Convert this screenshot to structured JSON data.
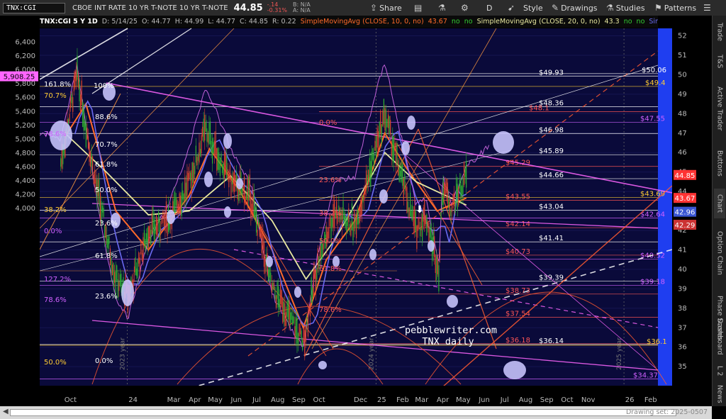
{
  "toolbar": {
    "symbol": "TNX:CGI",
    "description": "CBOE INT RATE 10 YR T-NOTE   10 YR T-NOTE",
    "last": "44.85",
    "change": "-.14",
    "change_pct": "-0.31%",
    "bid": "B: N/A",
    "ask": "A: N/A",
    "share": "Share",
    "aggregation": "D",
    "style": "Style",
    "drawings": "Drawings",
    "studies": "Studies",
    "patterns": "Patterns"
  },
  "study_bar": {
    "header": "TNX:CGI 5 Y 1D",
    "date": "D: 5/14/25",
    "open": "O: 44.77",
    "high": "H: 44.99",
    "low": "L: 44.77",
    "close": "C: 44.85",
    "range": "R: 0.22",
    "sma10": "SimpleMovingAvg (CLOSE, 10, 0, no)",
    "sma10_val": "43.67",
    "sma20": "SimpleMovingAvg (CLOSE, 20, 0, no)",
    "sma20_val": "43.3",
    "sma_other": "SimpleMoving...",
    "no": "no"
  },
  "right_tabs": [
    "Trade",
    "T&S",
    "Active Trader",
    "Buttons",
    "Chart",
    "Option Chain",
    "Phase Scores",
    "Dashboard",
    "L 2",
    "News"
  ],
  "drawing_set": "Drawing set: 2025-0507",
  "watermark": {
    "line1": "pebblewriter.com",
    "line2": "TNX daily"
  },
  "colors": {
    "bg": "#0a0a3a",
    "candle_up": "#2fb32f",
    "candle_down": "#e0452b",
    "sma10": "#ff6a2a",
    "sma20": "#e8e8a0",
    "sma50": "#6a6af0",
    "mauve": "#c060d8",
    "pink": "#ff66ff",
    "fib_orange": "#ff9a40",
    "white": "#ffffff"
  },
  "chart_data": {
    "type": "line",
    "title": "TNX:CGI 5 Y 1D",
    "right_axis": {
      "min": 34,
      "max": 52.5,
      "ticks": [
        35,
        36,
        37,
        38,
        39,
        40,
        41,
        42,
        43,
        44,
        45,
        46,
        47,
        48,
        49,
        50,
        51,
        52
      ]
    },
    "left_axis": {
      "ticks": [
        "4,000",
        "4,200",
        "4,400",
        "4,600",
        "4,800",
        "5,000",
        "5,200",
        "5,400",
        "5,600",
        "5,800",
        "6,000",
        "6,200",
        "6,400"
      ]
    },
    "x_ticks": [
      "Oct",
      "24",
      "Mar",
      "Apr",
      "May",
      "Jun",
      "Jul",
      "Aug",
      "Sep",
      "Oct",
      "Dec",
      "25",
      "Feb",
      "Mar",
      "Apr",
      "May",
      "Jun",
      "Jul",
      "Aug",
      "Sep",
      "Oct",
      "Nov",
      "26",
      "Feb"
    ],
    "year_labels": [
      "2023 year",
      "2024 year",
      "2025 year"
    ],
    "series": [
      {
        "name": "TNX close (approx.)",
        "x": [
          "2023-09-25",
          "2023-10-19",
          "2023-11-15",
          "2023-12-15",
          "2024-01-02",
          "2024-02-01",
          "2024-03-01",
          "2024-04-01",
          "2024-04-25",
          "2024-06-01",
          "2024-07-01",
          "2024-08-01",
          "2024-08-20",
          "2024-09-16",
          "2024-10-07",
          "2024-11-01",
          "2024-12-01",
          "2025-01-14",
          "2025-02-01",
          "2025-03-01",
          "2025-03-15",
          "2025-04-04",
          "2025-04-09",
          "2025-04-22",
          "2025-05-14"
        ],
        "values": [
          45.5,
          50.0,
          44.5,
          39.5,
          38.6,
          42.0,
          42.5,
          44.4,
          47.2,
          44.5,
          43.7,
          39.0,
          38.0,
          36.2,
          40.3,
          43.0,
          42.2,
          48.0,
          45.5,
          42.0,
          42.8,
          39.9,
          44.5,
          43.2,
          44.85
        ]
      },
      {
        "name": "SimpleMovingAvg (CLOSE, 10, 0, no)",
        "x": [
          "2023-10-01",
          "2023-11-01",
          "2023-12-15",
          "2024-02-01",
          "2024-04-01",
          "2024-05-01",
          "2024-06-15",
          "2024-08-01",
          "2024-09-16",
          "2024-10-20",
          "2024-12-01",
          "2025-01-14",
          "2025-02-15",
          "2025-04-01",
          "2025-05-14"
        ],
        "values": [
          46.8,
          48.5,
          43.0,
          41.0,
          43.8,
          46.2,
          44.0,
          41.0,
          37.0,
          40.5,
          42.5,
          47.0,
          45.2,
          43.0,
          43.67
        ]
      },
      {
        "name": "SimpleMovingAvg (CLOSE, 20, 0, no)",
        "x": [
          "2023-10-01",
          "2023-12-01",
          "2024-02-01",
          "2024-04-01",
          "2024-06-01",
          "2024-08-01",
          "2024-09-20",
          "2024-11-01",
          "2025-01-14",
          "2025-03-01",
          "2025-05-14"
        ],
        "values": [
          47.0,
          45.0,
          42.8,
          43.0,
          44.8,
          42.5,
          39.5,
          41.5,
          46.0,
          44.5,
          43.3
        ]
      }
    ],
    "price_levels": [
      {
        "label": "$50.06",
        "value": 50.06
      },
      {
        "label": "$49.93",
        "value": 49.93
      },
      {
        "label": "$49.4",
        "value": 49.4
      },
      {
        "label": "$48.36",
        "value": 48.36
      },
      {
        "label": "$48.1",
        "value": 48.1
      },
      {
        "label": "$47.55",
        "value": 47.55
      },
      {
        "label": "$46.98",
        "value": 46.98
      },
      {
        "label": "$45.89",
        "value": 45.89
      },
      {
        "label": "$45.29",
        "value": 45.29
      },
      {
        "label": "$44.66",
        "value": 44.66
      },
      {
        "label": "$43.69",
        "value": 43.69
      },
      {
        "label": "$43.55",
        "value": 43.55
      },
      {
        "label": "$43.04",
        "value": 43.04
      },
      {
        "label": "$42.64",
        "value": 42.64
      },
      {
        "label": "$42.14",
        "value": 42.14
      },
      {
        "label": "$41.41",
        "value": 41.41
      },
      {
        "label": "$40.73",
        "value": 40.73
      },
      {
        "label": "$40.52",
        "value": 40.52
      },
      {
        "label": "$39.39",
        "value": 39.39
      },
      {
        "label": "$39.18",
        "value": 39.18
      },
      {
        "label": "$38.73",
        "value": 38.73
      },
      {
        "label": "$37.54",
        "value": 37.54
      },
      {
        "label": "$36.18",
        "value": 36.18
      },
      {
        "label": "$36.14",
        "value": 36.14
      },
      {
        "label": "$36.1",
        "value": 36.1
      },
      {
        "label": "$34.37",
        "value": 34.37
      }
    ],
    "fib_labels": [
      "161.8%",
      "100%",
      "70.7%",
      "88.6%",
      "78.6%",
      "70.7%",
      "61.8%",
      "50.0%",
      "38.2%",
      "23.6%",
      "0.0%",
      "61.8%",
      "78.6%",
      "23.6%",
      "127.2%",
      "50.0%",
      "61.8%",
      "0.0%",
      "23.6%",
      "38.2%",
      "50.0%",
      "61.8%",
      "78.6%",
      "0.0%"
    ],
    "right_badges": [
      {
        "label": "44.85",
        "value": 44.85,
        "color": "#ff3333"
      },
      {
        "label": "43.67",
        "value": 43.67,
        "color": "#ff3333"
      },
      {
        "label": "42.96",
        "value": 42.96,
        "color": "#3a56d4"
      },
      {
        "label": "42.29",
        "value": 42.29,
        "color": "#cc3333"
      }
    ],
    "left_badge": {
      "label": "5,908.25",
      "value": 5908.25
    }
  }
}
